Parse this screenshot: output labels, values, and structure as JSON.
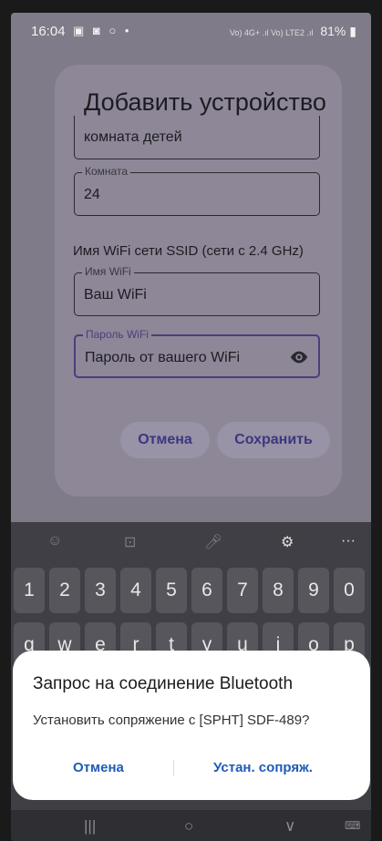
{
  "status_bar": {
    "time": "16:04",
    "notif_icons": "▣ ◙ ○ •",
    "signal": "Vo) 4G+ .ıl Vo) LTE2 .ıl",
    "battery": "81%"
  },
  "dialog": {
    "title": "Добавить устройство",
    "fields": {
      "name": {
        "value": "комната детей"
      },
      "room": {
        "label": "Комната",
        "value": "24"
      },
      "wifi_hint": "Имя WiFi сети SSID (сети с 2.4 GHz)",
      "wifi_name": {
        "label": "Имя WiFi",
        "value": "Ваш WiFi"
      },
      "wifi_password": {
        "label": "Пароль WiFi",
        "value": "Пароль от вашего WiFi"
      }
    },
    "cancel_label": "Отмена",
    "save_label": "Сохранить"
  },
  "keyboard": {
    "toolbar": [
      "☺",
      "⊡",
      "🎤︎",
      "⚙",
      "···"
    ],
    "row_numbers": [
      "1",
      "2",
      "3",
      "4",
      "5",
      "6",
      "7",
      "8",
      "9",
      "0"
    ],
    "row_letters": [
      "q",
      "w",
      "e",
      "r",
      "t",
      "y",
      "u",
      "i",
      "o",
      "p"
    ]
  },
  "bluetooth_prompt": {
    "title": "Запрос на соединение Bluetooth",
    "message": "Установить сопряжение с [SPHT] SDF-489?",
    "cancel_label": "Отмена",
    "pair_label": "Устан. сопряж."
  },
  "nav_bar": {
    "recents": "|||",
    "home": "○",
    "back": "∨",
    "keyboard": "⌨"
  },
  "colors": {
    "accent": "#4a3f7a",
    "link": "#1f5bb5",
    "overlay": "#7f7b88"
  }
}
